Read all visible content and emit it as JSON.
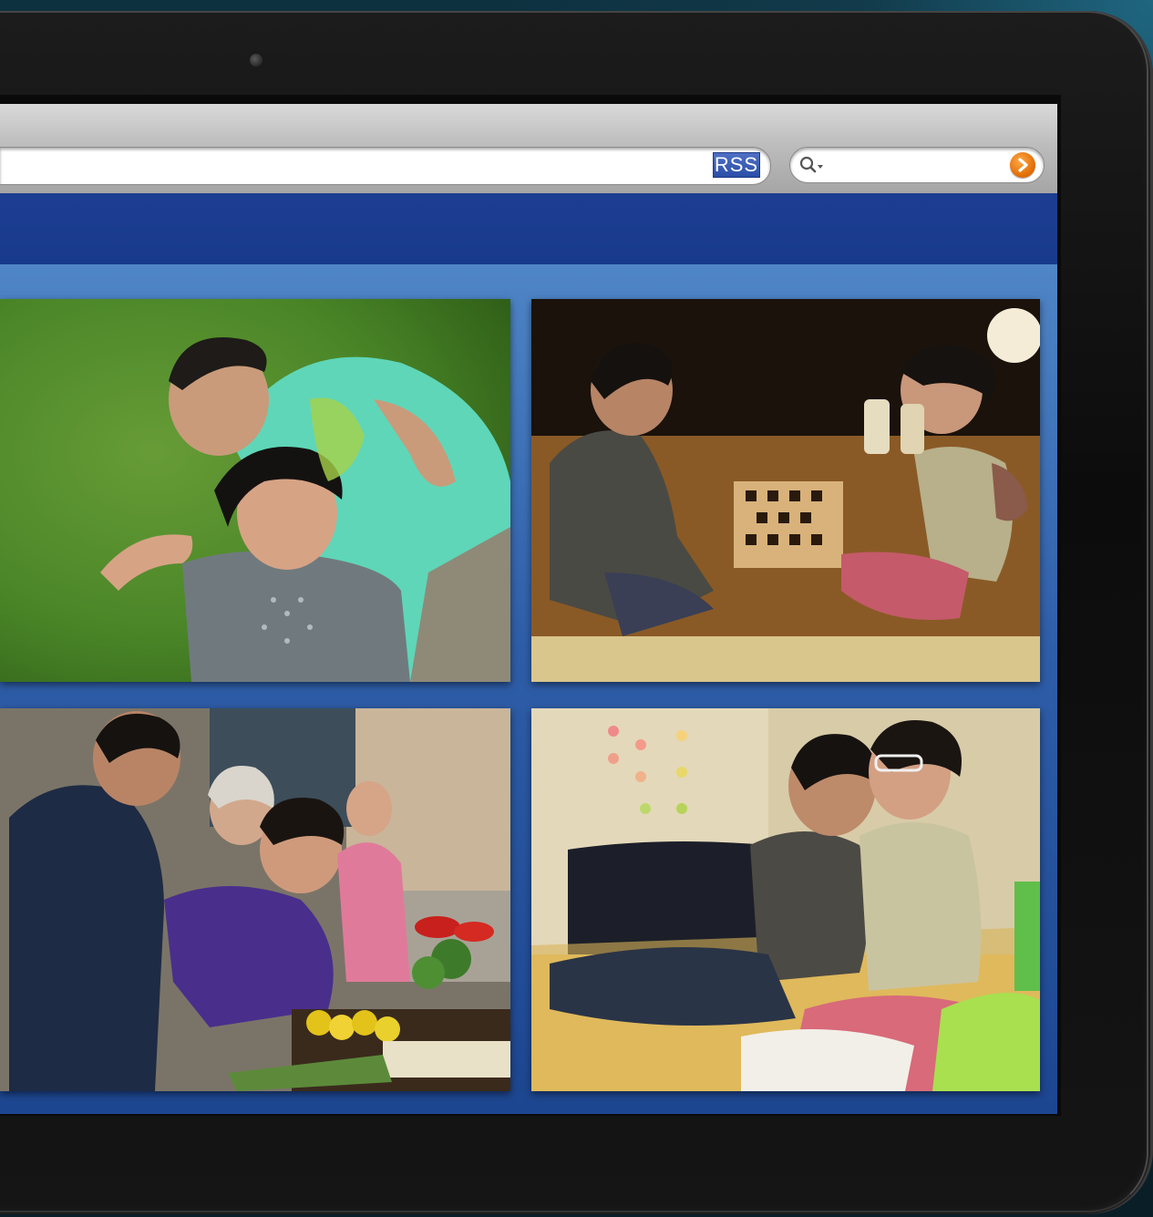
{
  "browser": {
    "rss_label": "RSS",
    "search_placeholder": "",
    "search_icon": "magnifier-dropdown-icon",
    "go_icon": "arrow-right-icon"
  },
  "gallery": {
    "photos": [
      {
        "name": "couple-on-grass-photo"
      },
      {
        "name": "couple-playing-chess-photo"
      },
      {
        "name": "couple-at-market-photo"
      },
      {
        "name": "couple-on-sofa-photo"
      }
    ]
  },
  "colors": {
    "nav_bar": "#1a3b8e",
    "content_bg": "#3a6bb3",
    "rss_badge": "#3a5fb8",
    "search_go": "#f07d10"
  }
}
